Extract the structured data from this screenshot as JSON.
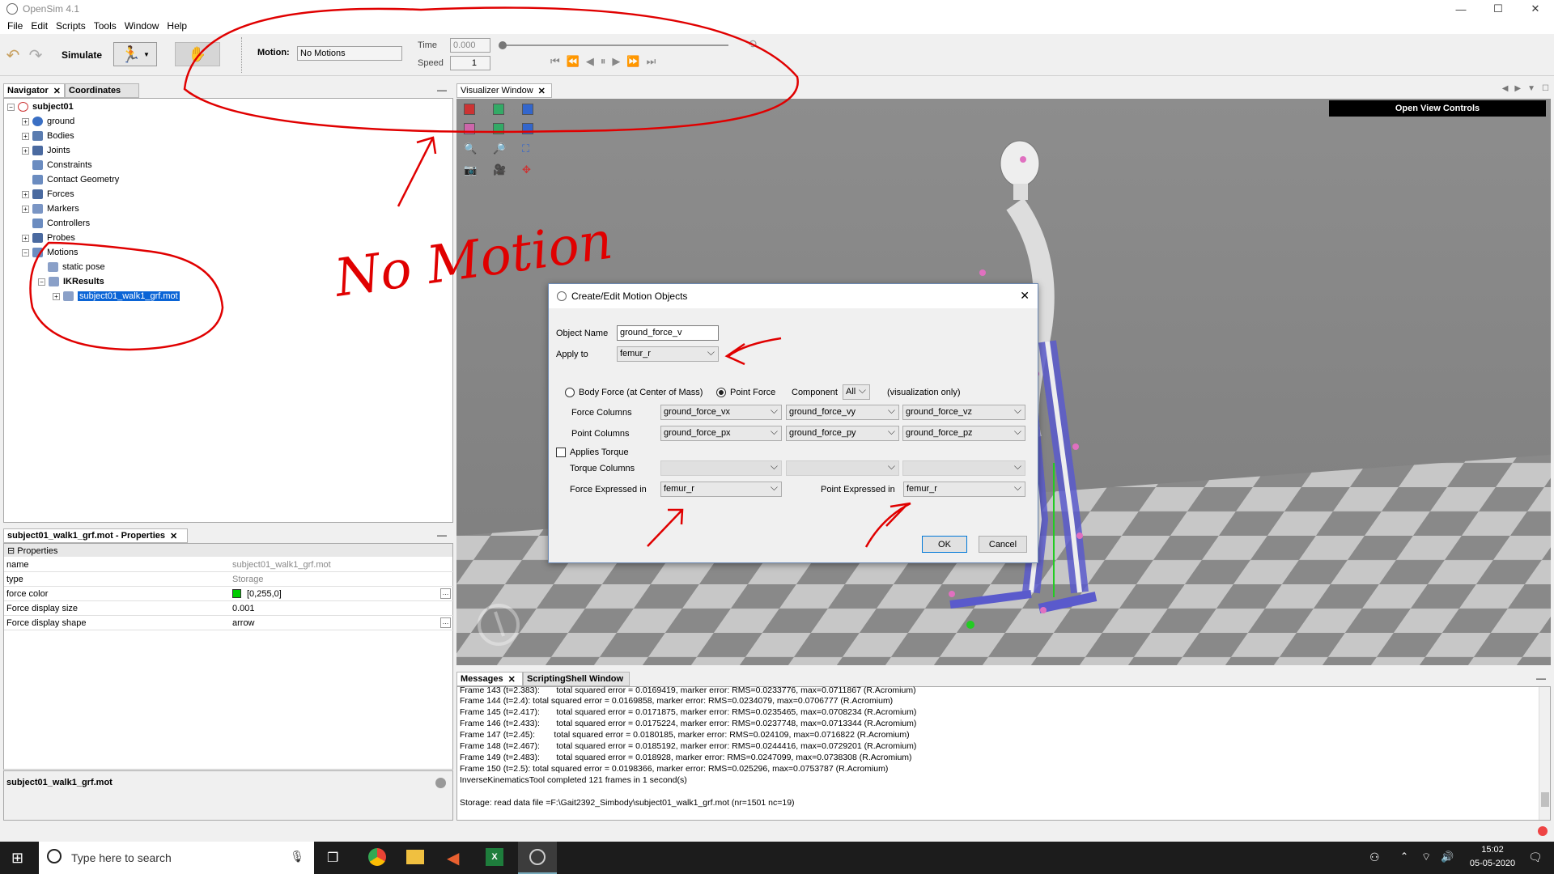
{
  "app": {
    "title": "OpenSim 4.1"
  },
  "window_controls": {
    "minimize": "—",
    "maximize": "☐",
    "close": "✕"
  },
  "menu": [
    "File",
    "Edit",
    "Scripts",
    "Tools",
    "Window",
    "Help"
  ],
  "toolbar": {
    "simulate_label": "Simulate",
    "motion_label": "Motion:",
    "motion_value": "No Motions",
    "time_label": "Time",
    "time_value": "0.000",
    "speed_label": "Speed",
    "speed_value": "1"
  },
  "navigator": {
    "tabs": [
      "Navigator",
      "Coordinates"
    ],
    "model": "subject01",
    "items": [
      "ground",
      "Bodies",
      "Joints",
      "Constraints",
      "Contact Geometry",
      "Forces",
      "Markers",
      "Controllers",
      "Probes",
      "Motions"
    ],
    "motions": [
      "static pose",
      "IKResults"
    ],
    "selected": "subject01_walk1_grf.mot"
  },
  "properties": {
    "tab": "subject01_walk1_grf.mot - Properties",
    "section": "Properties",
    "rows": [
      {
        "key": "name",
        "value": "subject01_walk1_grf.mot"
      },
      {
        "key": "type",
        "value": "Storage"
      },
      {
        "key": "force color",
        "value": "[0,255,0]"
      },
      {
        "key": "Force display size",
        "value": "0.001"
      },
      {
        "key": "Force display shape",
        "value": "arrow"
      }
    ],
    "footer": "subject01_walk1_grf.mot",
    "force_color": "#00cc00"
  },
  "visualizer": {
    "tab": "Visualizer Window",
    "view_controls": "Open View Controls"
  },
  "dialog": {
    "title": "Create/Edit Motion Objects",
    "object_name_label": "Object Name",
    "object_name_value": "ground_force_v",
    "apply_to_label": "Apply to",
    "apply_to_value": "femur_r",
    "body_force_label": "Body Force (at Center of Mass)",
    "point_force_label": "Point Force",
    "component_label": "Component",
    "component_value": "All",
    "viz_only": "(visualization only)",
    "force_columns_label": "Force Columns",
    "force_columns": [
      "ground_force_vx",
      "ground_force_vy",
      "ground_force_vz"
    ],
    "point_columns_label": "Point Columns",
    "point_columns": [
      "ground_force_px",
      "ground_force_py",
      "ground_force_pz"
    ],
    "applies_torque_label": "Applies Torque",
    "torque_columns_label": "Torque Columns",
    "force_expressed_label": "Force Expressed in",
    "force_expressed_value": "femur_r",
    "point_expressed_label": "Point Expressed in",
    "point_expressed_value": "femur_r",
    "ok": "OK",
    "cancel": "Cancel"
  },
  "messages": {
    "tabs": [
      "Messages",
      "ScriptingShell Window"
    ],
    "lines": [
      "Frame 143 (t=2.383):       total squared error = 0.0169419, marker error: RMS=0.0233776, max=0.0711867 (R.Acromium)",
      "Frame 144 (t=2.4): total squared error = 0.0169858, marker error: RMS=0.0234079, max=0.0706777 (R.Acromium)",
      "Frame 145 (t=2.417):       total squared error = 0.0171875, marker error: RMS=0.0235465, max=0.0708234 (R.Acromium)",
      "Frame 146 (t=2.433):       total squared error = 0.0175224, marker error: RMS=0.0237748, max=0.0713344 (R.Acromium)",
      "Frame 147 (t=2.45):        total squared error = 0.0180185, marker error: RMS=0.024109, max=0.0716822 (R.Acromium)",
      "Frame 148 (t=2.467):       total squared error = 0.0185192, marker error: RMS=0.0244416, max=0.0729201 (R.Acromium)",
      "Frame 149 (t=2.483):       total squared error = 0.018928, marker error: RMS=0.0247099, max=0.0738308 (R.Acromium)",
      "Frame 150 (t=2.5): total squared error = 0.0198366, marker error: RMS=0.025296, max=0.0753787 (R.Acromium)",
      "InverseKinematicsTool completed 121 frames in 1 second(s)",
      "",
      "Storage: read data file =F:\\Gait2392_Simbody\\subject01_walk1_grf.mot (nr=1501 nc=19)"
    ]
  },
  "taskbar": {
    "search_placeholder": "Type here to search",
    "time": "15:02",
    "date": "05-05-2020"
  },
  "annotations": {
    "text": "No Motion",
    "color": "#e00000"
  }
}
